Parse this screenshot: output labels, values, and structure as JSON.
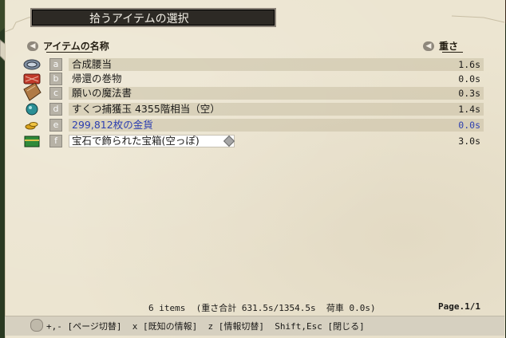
{
  "window": {
    "title": "拾うアイテムの選択"
  },
  "header": {
    "name": "アイテムの名称",
    "weight": "重さ"
  },
  "items": [
    {
      "key": "a",
      "name": "合成腰当",
      "weight": "1.6s",
      "icon": "belt-icon"
    },
    {
      "key": "b",
      "name": "帰還の巻物",
      "weight": "0.0s",
      "icon": "scroll-icon"
    },
    {
      "key": "c",
      "name": "願いの魔法書",
      "weight": "0.3s",
      "icon": "spellbook-icon"
    },
    {
      "key": "d",
      "name": "すくつ捕獲玉 4355階相当（空）",
      "weight": "1.4s",
      "icon": "capture-ball-icon"
    },
    {
      "key": "e",
      "name": "299,812枚の金貨",
      "weight": "0.0s",
      "icon": "gold-coins-icon"
    },
    {
      "key": "f",
      "name": "宝石で飾られた宝箱(空っぽ)",
      "weight": "3.0s",
      "icon": "treasure-chest-icon"
    }
  ],
  "status": {
    "count": "6 items",
    "total_weight": "(重さ合計 631.5s/1354.5s",
    "cargo": "荷車 0.0s)",
    "page": "Page.1/1"
  },
  "help": {
    "text": "+,- [ページ切替]  x [既知の情報]  z [情報切替]  Shift,Esc [閉じる]"
  },
  "colors": {
    "gold_text": "#2d3fb0",
    "panel": "#ece5d1",
    "title_bg": "#2d2a25"
  }
}
